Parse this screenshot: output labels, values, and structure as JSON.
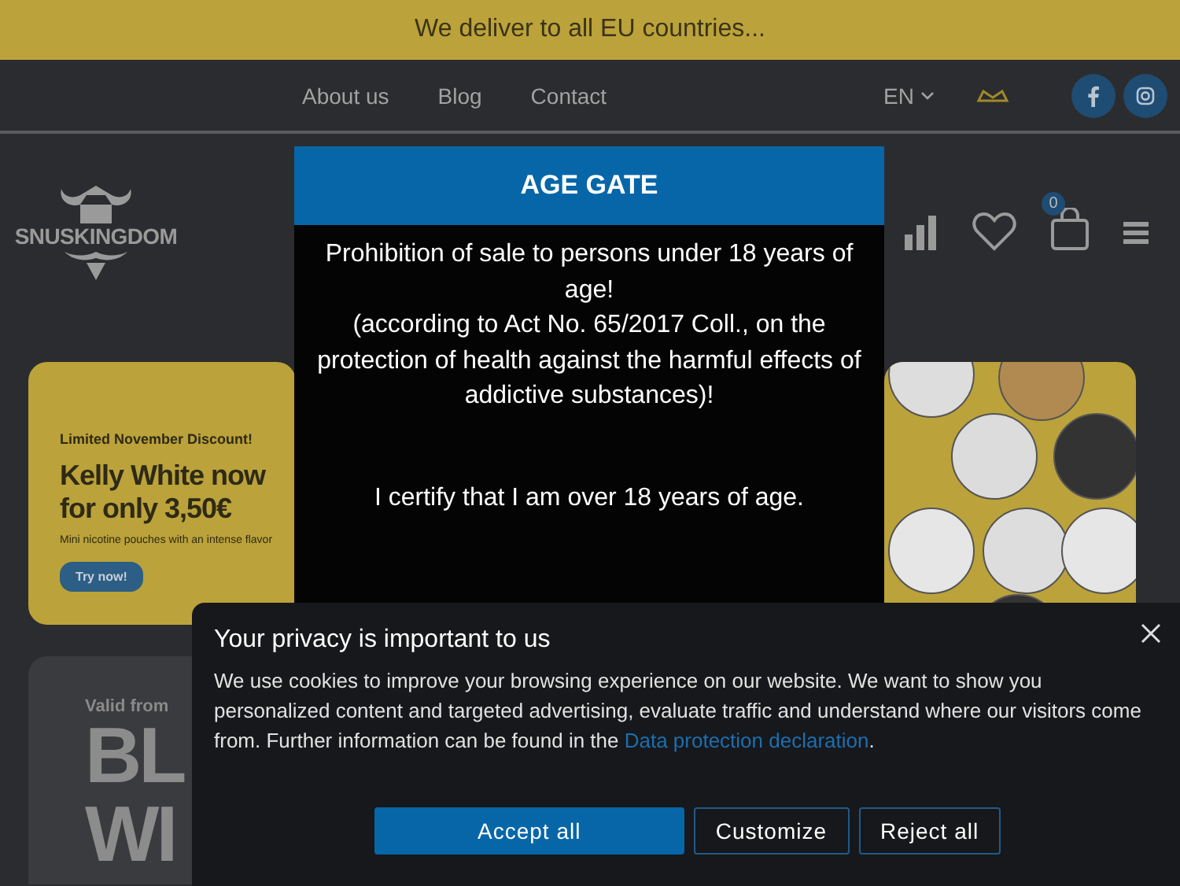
{
  "top_bar": {
    "text": "We deliver to all EU countries..."
  },
  "nav": {
    "links": [
      "About us",
      "Blog",
      "Contact"
    ],
    "language": "EN"
  },
  "header": {
    "logo": "SNUSKINGDOM",
    "cart_count": "0"
  },
  "banners": [
    {
      "kind": "promo",
      "eyebrow": "Limited November Discount!",
      "headline": [
        "Kelly White now",
        "for only 3,50€"
      ],
      "subtitle": "Mini nicotine pouches with an intense flavor",
      "button": "Try now!"
    },
    {
      "kind": "tins"
    },
    {
      "kind": "dark",
      "eyebrow": "Valid from",
      "headline": [
        "BL",
        "WI"
      ]
    }
  ],
  "age_gate": {
    "title": "AGE GATE",
    "message": "Prohibition of sale to persons under 18 years of age!\n(according to Act No. 65/2017 Coll., on the protection of health against the harmful effects of addictive substances)!",
    "certify": "I certify that I am over 18 years of age."
  },
  "cookie_banner": {
    "title": "Your privacy is important to us",
    "text": "We use cookies to improve your browsing experience on our website. We want to show you personalized content and targeted advertising, evaluate traffic and understand where our visitors come from. Further information can be found in the ",
    "link": "Data protection declaration",
    "text_end": ".",
    "buttons": [
      {
        "label": "Accept all",
        "kind": "primary"
      },
      {
        "label": "Customize",
        "kind": "outline"
      },
      {
        "label": "Reject all",
        "kind": "outline"
      }
    ]
  }
}
